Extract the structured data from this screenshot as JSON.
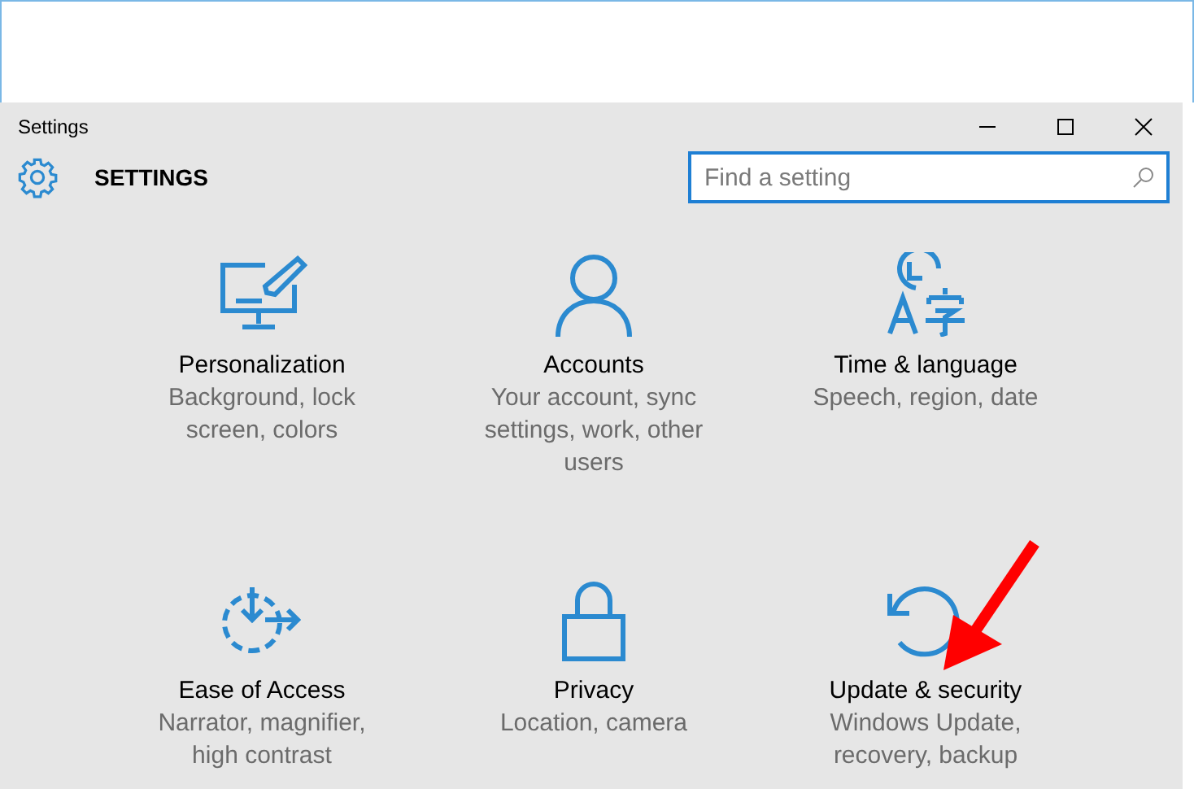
{
  "window": {
    "title": "Settings"
  },
  "header": {
    "title": "SETTINGS"
  },
  "search": {
    "placeholder": "Find a setting"
  },
  "tiles": [
    {
      "kind": "personalization",
      "title": "Personalization",
      "description": "Background, lock screen, colors"
    },
    {
      "kind": "accounts",
      "title": "Accounts",
      "description": "Your account, sync settings, work, other users"
    },
    {
      "kind": "time",
      "title": "Time & language",
      "description": "Speech, region, date"
    },
    {
      "kind": "ease",
      "title": "Ease of Access",
      "description": "Narrator, magnifier, high contrast"
    },
    {
      "kind": "privacy",
      "title": "Privacy",
      "description": "Location, camera"
    },
    {
      "kind": "update",
      "title": "Update & security",
      "description": "Windows Update, recovery, backup"
    }
  ]
}
